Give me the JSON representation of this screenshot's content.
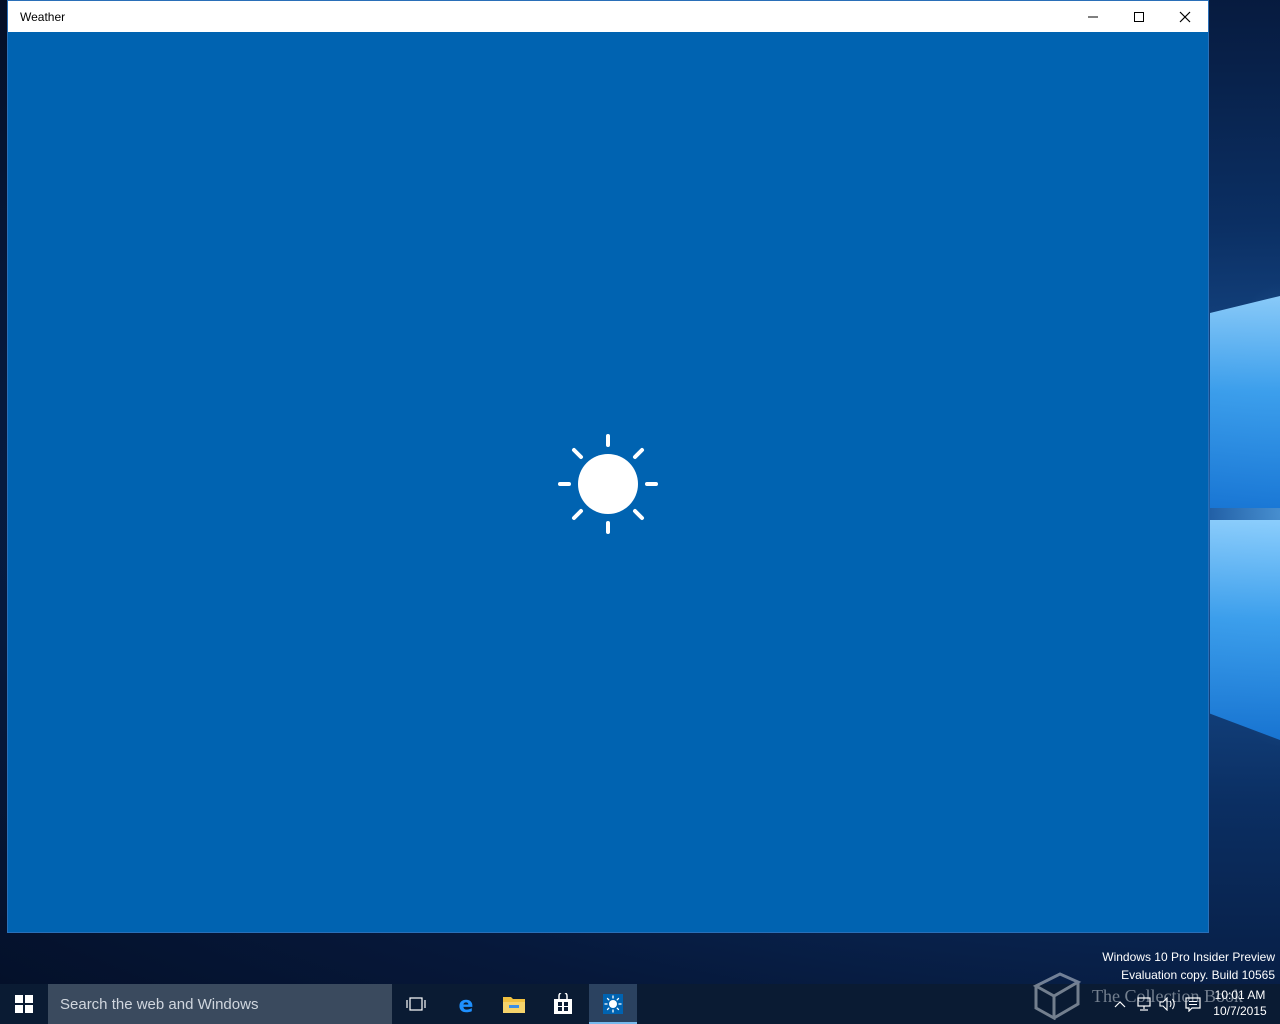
{
  "window": {
    "title": "Weather",
    "minimize_icon": "minimize-icon",
    "maximize_icon": "maximize-icon",
    "close_icon": "close-icon",
    "background": "#0063b1"
  },
  "splash": {
    "icon": "sun-icon"
  },
  "watermark": {
    "line1": "Windows 10 Pro Insider Preview",
    "line2": "Evaluation copy. Build 10565"
  },
  "taskbar": {
    "search_placeholder": "Search the web and Windows",
    "apps": [
      "task-view-icon",
      "edge-icon",
      "file-explorer-icon",
      "store-icon",
      "weather-icon"
    ],
    "clock": {
      "time": "10:01 AM",
      "date": "10/7/2015"
    },
    "overlay_text": "The Collection Book"
  }
}
